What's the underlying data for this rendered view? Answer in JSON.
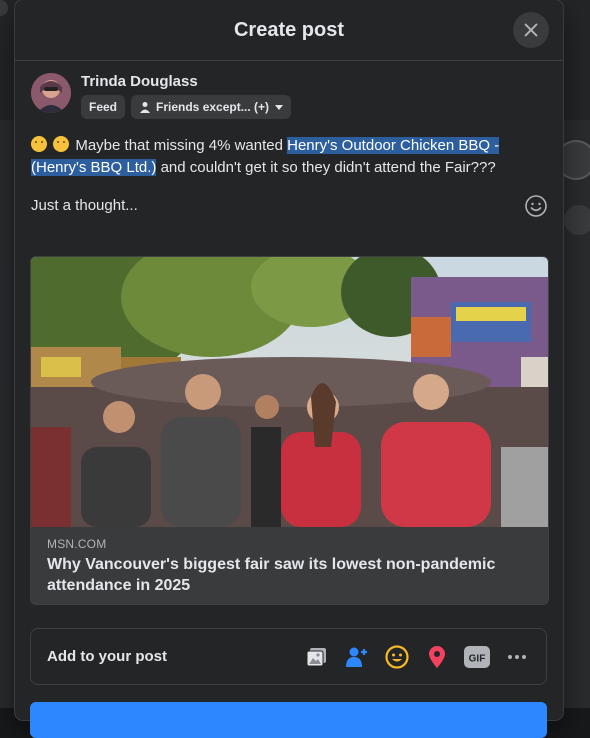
{
  "dialog": {
    "title": "Create post"
  },
  "author": {
    "name": "Trinda Douglass",
    "audience_chip": "Feed",
    "privacy_chip": "Friends except... (+)"
  },
  "post": {
    "text_before": "Maybe that missing 4% wanted ",
    "text_highlighted": "Henry's Outdoor Chicken BBQ - (Henry's BBQ Ltd.)",
    "text_after": " and couldn't get it so they didn't attend the Fair???",
    "second_line": "Just a thought...",
    "leading_emoji": [
      "thinking-face",
      "thinking-face"
    ]
  },
  "link_preview": {
    "source": "MSN.COM",
    "title": "Why Vancouver's biggest fair saw its lowest non-pandemic attendance in 2025"
  },
  "add_to_post": {
    "label": "Add to your post",
    "icons": [
      "photo-video-icon",
      "tag-people-icon",
      "feeling-icon",
      "check-in-icon",
      "gif-icon",
      "more-icon"
    ],
    "gif_label": "GIF"
  },
  "colors": {
    "modal_bg": "#242526",
    "highlight": "#2d5e9e",
    "primary": "#2d88ff",
    "tag_blue": "#2d88ff",
    "feeling_yellow": "#f7b928",
    "location_red": "#f3425f"
  }
}
